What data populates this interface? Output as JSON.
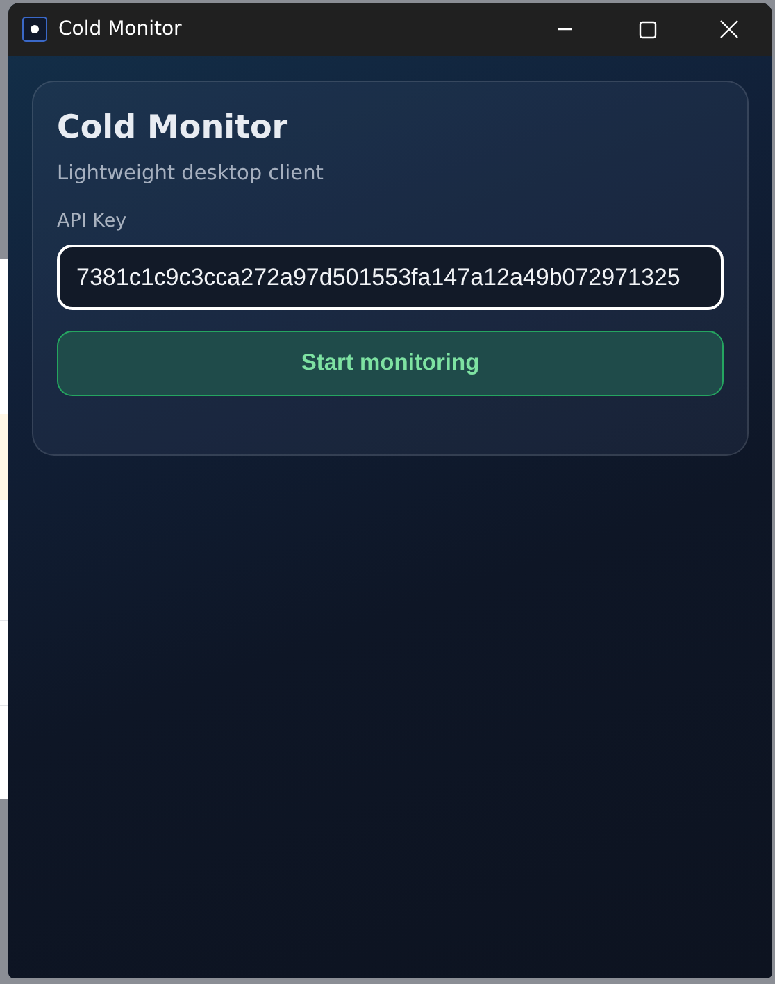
{
  "window": {
    "title": "Cold Monitor"
  },
  "card": {
    "title": "Cold Monitor",
    "subtitle": "Lightweight desktop client"
  },
  "api_key": {
    "label": "API Key",
    "value": "7381c1c9c3cca272a97d501553fa147a12a49b072971325",
    "focused": true
  },
  "buttons": [
    {
      "label": "Start monitoring"
    }
  ]
}
